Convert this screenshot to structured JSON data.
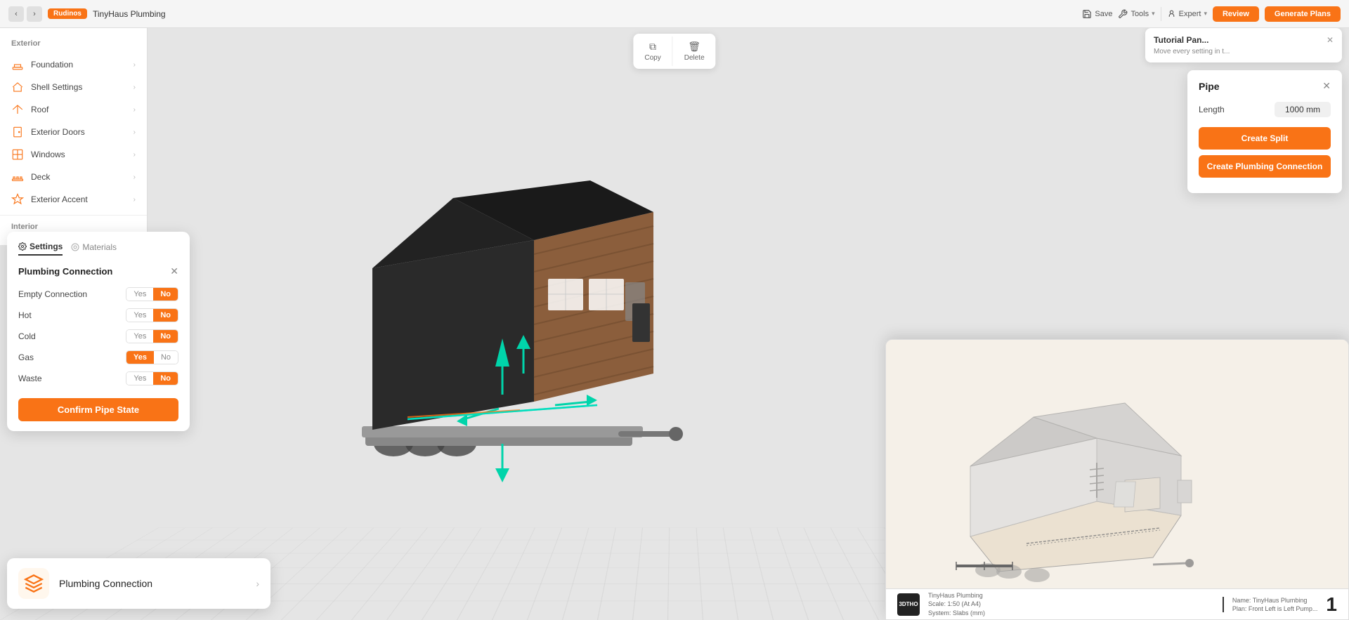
{
  "header": {
    "back_btn": "‹",
    "forward_btn": "›",
    "breadcrumb": "Rudinos",
    "project_title": "TinyHaus Plumbing",
    "save_label": "Save",
    "tools_label": "Tools",
    "copy_label": "Copy",
    "delete_label": "Delete",
    "expert_label": "Expert",
    "review_label": "Review",
    "generate_plans_label": "Generate Plans"
  },
  "sidebar": {
    "exterior_title": "Exterior",
    "items": [
      {
        "label": "Foundation",
        "icon": "foundation"
      },
      {
        "label": "Shell Settings",
        "icon": "shell"
      },
      {
        "label": "Roof",
        "icon": "roof"
      },
      {
        "label": "Exterior Doors",
        "icon": "door"
      },
      {
        "label": "Windows",
        "icon": "window"
      },
      {
        "label": "Deck",
        "icon": "deck"
      },
      {
        "label": "Exterior Accent",
        "icon": "accent"
      }
    ],
    "interior_title": "Interior"
  },
  "plumbing_panel": {
    "tab_settings": "Settings",
    "tab_materials": "Materials",
    "title": "Plumbing Connection",
    "rows": [
      {
        "label": "Empty Connection",
        "yes": "Yes",
        "no": "No",
        "selected": "no"
      },
      {
        "label": "Hot",
        "yes": "Yes",
        "no": "No",
        "selected": "no"
      },
      {
        "label": "Cold",
        "yes": "Yes",
        "no": "No",
        "selected": "no"
      },
      {
        "label": "Gas",
        "yes": "Yes",
        "no": "No",
        "selected": "yes"
      },
      {
        "label": "Waste",
        "yes": "Yes",
        "no": "No",
        "selected": "no"
      }
    ],
    "confirm_btn": "Confirm Pipe State"
  },
  "notification": {
    "icon": "🔧",
    "text": "Plumbing Connection",
    "chevron": "›"
  },
  "tutorial_panel": {
    "title": "Tutorial Pan...",
    "subtitle": "Move every setting in t...",
    "close": "✕"
  },
  "pipe_panel": {
    "title": "Pipe",
    "close": "✕",
    "length_label": "Length",
    "length_value": "1000 mm",
    "create_split_btn": "Create Split",
    "create_plumbing_btn": "Create Plumbing Connection"
  },
  "blueprint": {
    "logo": "3DTHO",
    "title": "TinyHaus Plumbing",
    "scale": "Scale: 1:50 (At A4)",
    "system": "System: Slabs (mm)",
    "plan": "Plan: Front Left is Left Pump...",
    "page_num": "1"
  }
}
